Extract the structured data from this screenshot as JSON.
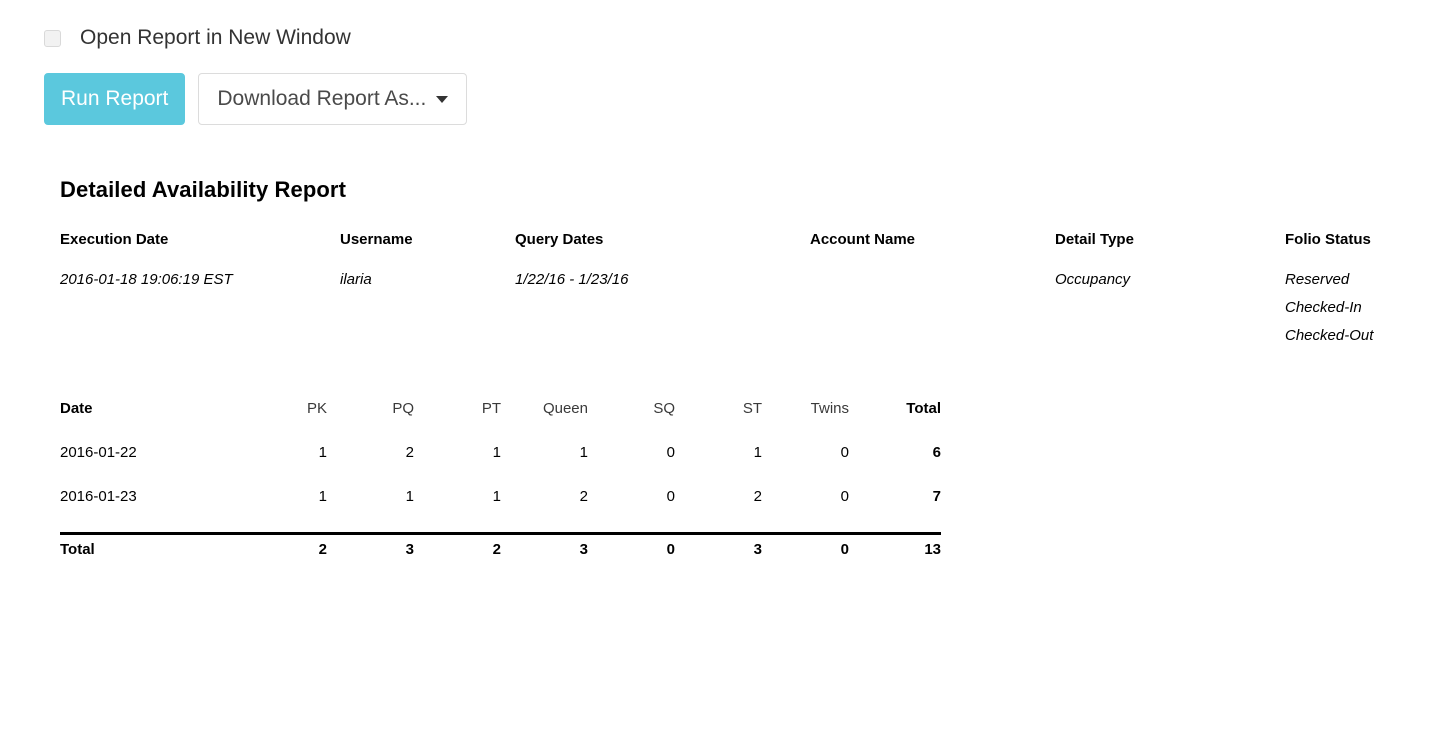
{
  "controls": {
    "open_in_new_window_label": "Open Report in New Window",
    "open_in_new_window_checked": false,
    "run_report_label": "Run Report",
    "download_label": "Download Report As...",
    "accent_color": "#5bc8dd"
  },
  "report": {
    "title": "Detailed Availability Report",
    "meta": {
      "headers": [
        "Execution Date",
        "Username",
        "Query Dates",
        "Account Name",
        "Detail Type",
        "Folio Status"
      ],
      "values": {
        "execution_date": "2016-01-18 19:06:19 EST",
        "username": "ilaria",
        "query_dates": "1/22/16 - 1/23/16",
        "account_name": "",
        "detail_type": "Occupancy",
        "folio_status": [
          "Reserved",
          "Checked-In",
          "Checked-Out"
        ]
      }
    },
    "table": {
      "columns": [
        "Date",
        "PK",
        "PQ",
        "PT",
        "Queen",
        "SQ",
        "ST",
        "Twins",
        "Total"
      ],
      "rows": [
        {
          "date": "2016-01-22",
          "pk": "1",
          "pq": "2",
          "pt": "1",
          "queen": "1",
          "sq": "0",
          "st": "1",
          "twins": "0",
          "total": "6"
        },
        {
          "date": "2016-01-23",
          "pk": "1",
          "pq": "1",
          "pt": "1",
          "queen": "2",
          "sq": "0",
          "st": "2",
          "twins": "0",
          "total": "7"
        }
      ],
      "totals": {
        "date": "Total",
        "pk": "2",
        "pq": "3",
        "pt": "2",
        "queen": "3",
        "sq": "0",
        "st": "3",
        "twins": "0",
        "total": "13"
      }
    }
  }
}
